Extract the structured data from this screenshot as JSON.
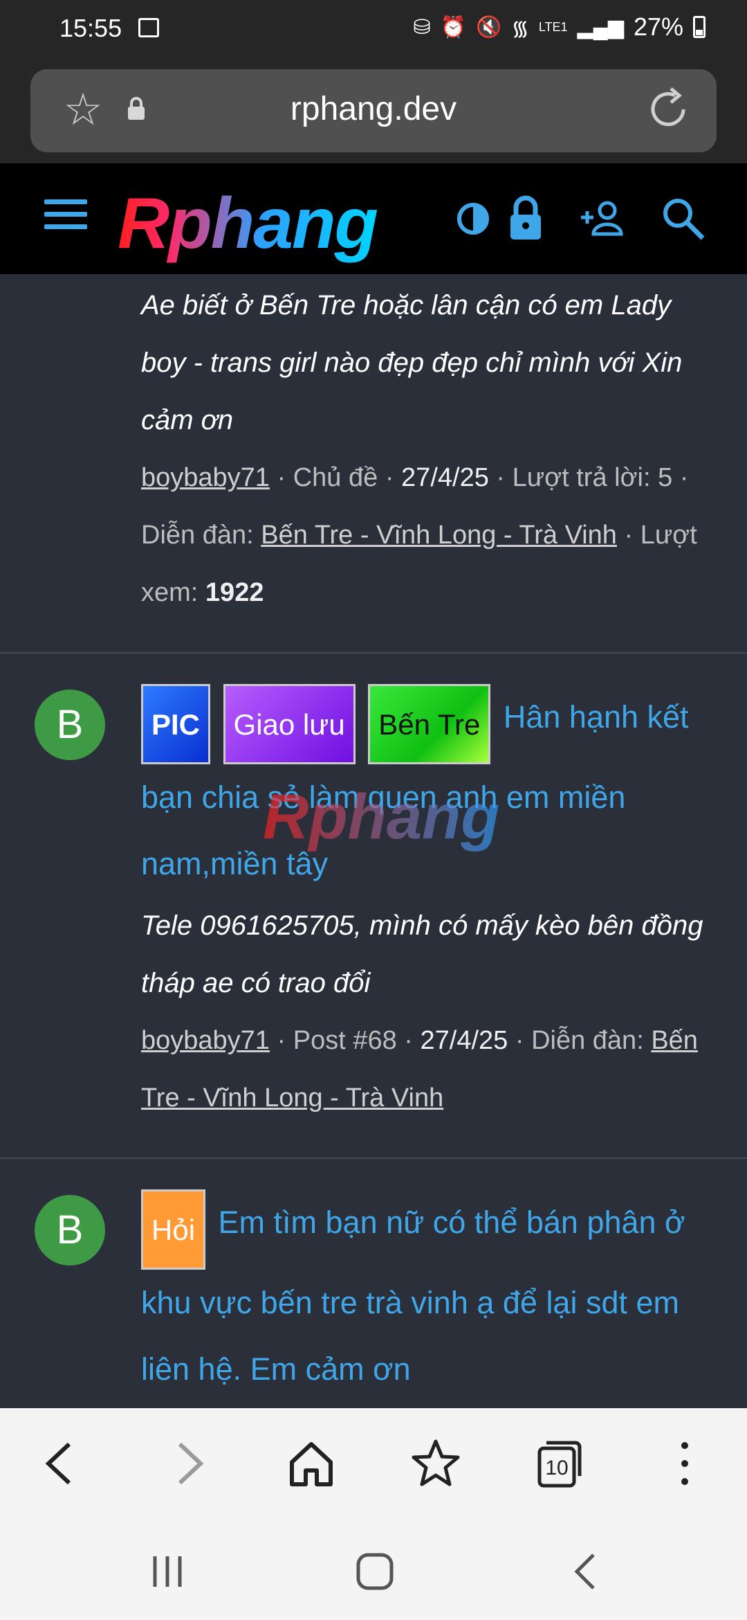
{
  "status": {
    "time": "15:55",
    "battery": "27%",
    "network": "LTE1"
  },
  "browser": {
    "url": "rphang.dev"
  },
  "site": {
    "logo": "Rphang",
    "watermark": "Rphang"
  },
  "posts": [
    {
      "snippet": "Ae biết ở Bến Tre hoặc lân cận có em Lady boy - trans girl nào đẹp đẹp chỉ mình với Xin cảm ơn",
      "author": "boybaby71",
      "kind": "Chủ đề",
      "date": "27/4/25",
      "replies_label": "Lượt trả lời:",
      "replies": "5",
      "forum_label": "Diễn đàn:",
      "forum": "Bến Tre - Vĩnh Long - Trà Vinh",
      "views_label": "Lượt xem:",
      "views": "1922"
    },
    {
      "avatar": "B",
      "tags": [
        "PIC",
        "Giao lưu",
        "Bến Tre"
      ],
      "title": "Hân hạnh kết bạn chia sẻ làm quen anh em miền nam,miền tây",
      "snippet": "Tele 0961625705, mình có mấy kèo bên đồng tháp ae có trao đổi",
      "author": "boybaby71",
      "post_no": "Post #68",
      "date": "27/4/25",
      "forum_label": "Diễn đàn:",
      "forum": "Bến Tre - Vĩnh Long - Trà Vinh"
    },
    {
      "avatar": "B",
      "tags": [
        "Hỏi"
      ],
      "title": "Em tìm bạn nữ có thể bán phân ở khu vực bến tre trà vinh ạ để lại sdt em liên hệ. Em cảm ơn"
    }
  ],
  "bottom_nav": {
    "tabs_count": "10"
  }
}
